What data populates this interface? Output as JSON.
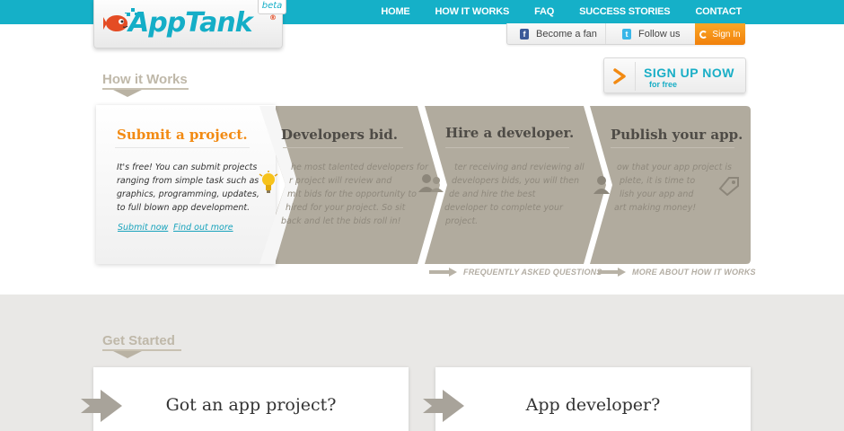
{
  "header": {
    "logo_text": "AppTank",
    "logo_reg": "®",
    "beta_label": "beta",
    "nav": [
      "HOME",
      "HOW IT WORKS",
      "FAQ",
      "SUCCESS STORIES",
      "CONTACT"
    ],
    "become_fan": "Become a fan",
    "follow_us": "Follow us",
    "sign_in": "Sign In"
  },
  "how_it_works": {
    "heading": "How it Works",
    "signup_main": "SIGN UP NOW",
    "signup_sub": "for free",
    "steps": [
      {
        "title": "Submit a project.",
        "lines": [
          "It's free! You can submit projects",
          "ranging from simple task such as",
          "graphics, programming, updates,",
          "to full blown app development."
        ],
        "links": [
          "Submit now",
          "Find out more"
        ]
      },
      {
        "title": "Developers bid.",
        "lines": [
          "he most talented developers for",
          "r project will review and",
          "mit bids for the opportunity to",
          "hired for your project. So sit",
          "back and let the bids roll in!"
        ]
      },
      {
        "title": "Hire a developer.",
        "lines": [
          "ter receiving and reviewing all",
          "developers bids, you will then",
          "de and hire the best",
          "developer to complete your",
          "project."
        ]
      },
      {
        "title": "Publish your app.",
        "lines": [
          "ow that your app project is",
          "plete, it is time to",
          "lish your app and",
          "art making money!"
        ]
      }
    ],
    "faq_link": "FREQUENTLY ASKED QUESTIONS",
    "more_link": "MORE ABOUT HOW IT WORKS"
  },
  "get_started": {
    "heading": "Get Started",
    "cards": [
      "Got an app project?",
      "App developer?"
    ]
  },
  "colors": {
    "brand_teal": "#15b0c8",
    "accent_orange": "#f28a12",
    "step_gray": "#b1ab9e"
  }
}
